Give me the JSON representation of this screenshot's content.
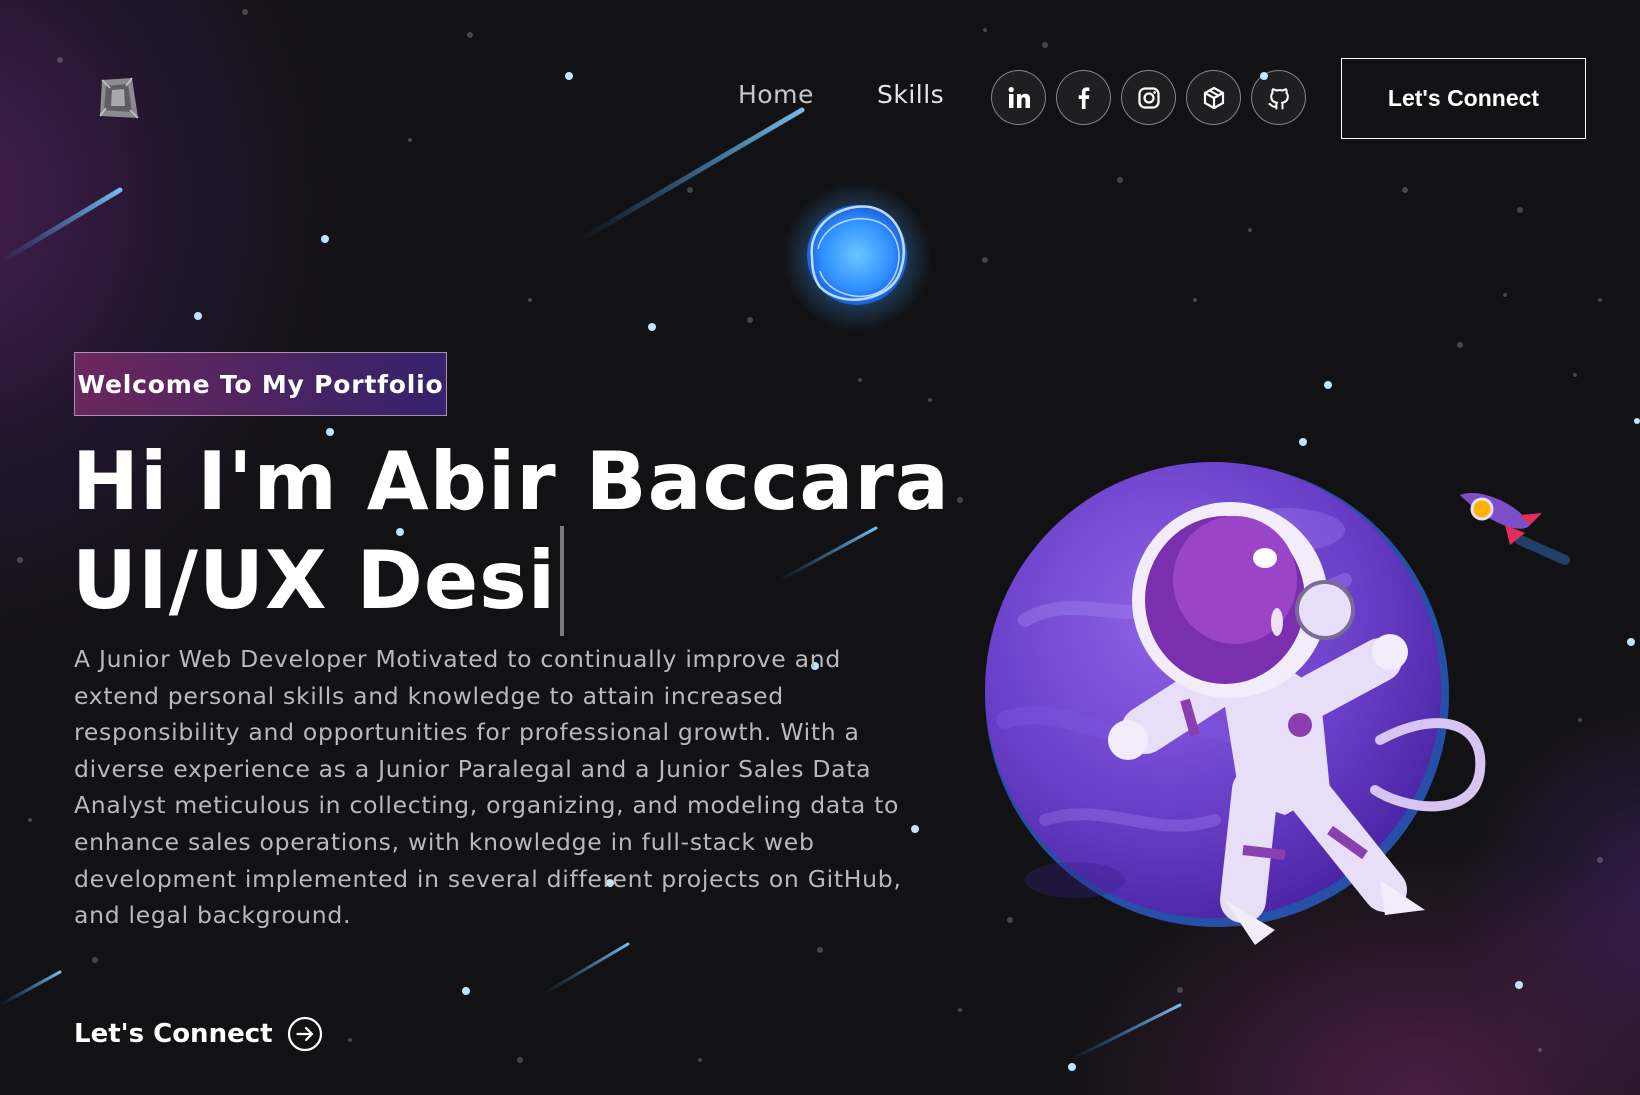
{
  "nav": {
    "logo": "logo-icon",
    "links": [
      {
        "label": "Home",
        "icon": ""
      },
      {
        "label": "Skills",
        "icon": ""
      }
    ],
    "social_icons": [
      "linkedin-icon",
      "facebook-icon",
      "instagram-icon",
      "cube-icon",
      "github-icon"
    ],
    "connect_label": "Let's Connect"
  },
  "hero": {
    "tagline": "Welcome To My Portfolio",
    "headline_line1": "Hi I'm Abir Baccara",
    "headline_line2": "UI/UX Desi",
    "bio_lines": [
      "A Junior Web Developer Motivated to continually improve and",
      "extend personal skills and knowledge to attain increased",
      "responsibility and opportunities for professional growth. With a",
      "diverse experience as a Junior Paralegal and a Junior Sales Data",
      "Analyst meticulous in collecting, organizing, and modeling data to",
      "enhance sales operations, with knowledge in full-stack web",
      "development implemented in several different projects on GitHub,",
      "and legal background."
    ],
    "cta_label": "Let's Connect",
    "cta_icon": "arrow-right-circle-icon"
  },
  "colors": {
    "background": "#121214",
    "tagline_gradient_start": "#aa367c",
    "tagline_gradient_end": "#4a2fbd",
    "planet": "#6a3fc8",
    "small_planet": "#4aa8ff"
  }
}
